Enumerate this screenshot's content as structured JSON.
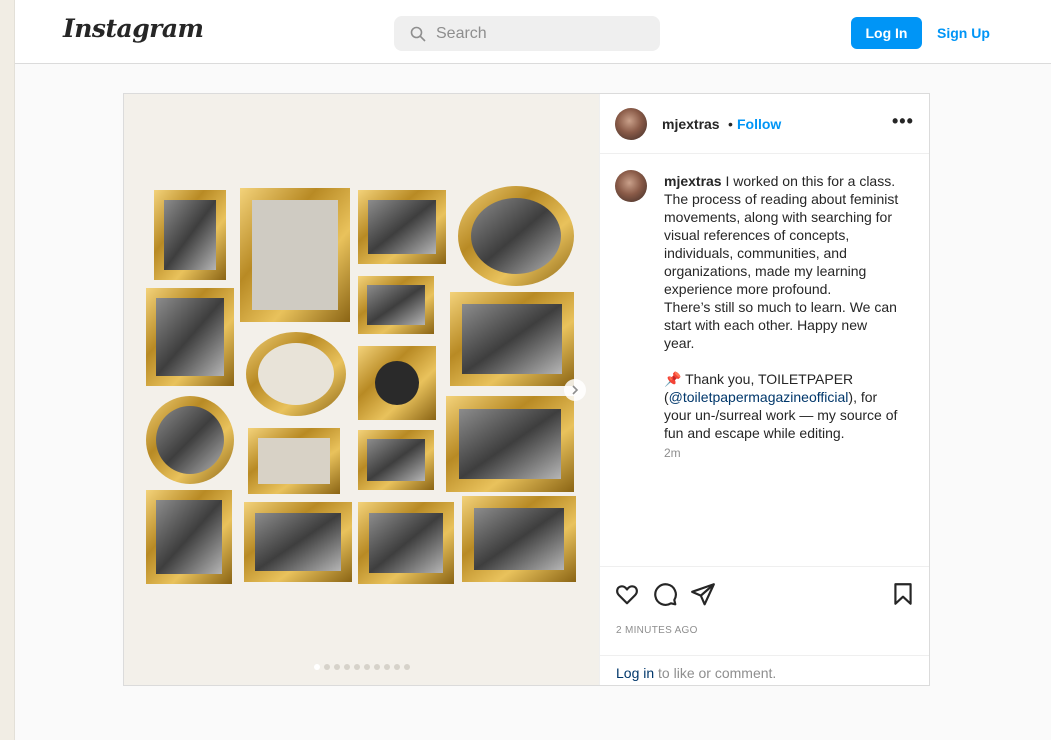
{
  "header": {
    "logo_text": "Instagram",
    "search_placeholder": "Search",
    "login_label": "Log In",
    "signup_label": "Sign Up"
  },
  "post": {
    "username": "mjextras",
    "separator": "•",
    "follow_label": "Follow",
    "more_label": "•••",
    "caption_username": "mjextras",
    "caption_lines": [
      "I worked on this for a class.",
      "The process of reading about feminist",
      "movements, along with searching for",
      "visual references of concepts,",
      "individuals, communities, and",
      "organizations, made my learning",
      "experience more profound.",
      "There’s still so much to learn. We can",
      "start with each other. Happy new",
      "year."
    ],
    "thanks_prefix": "Thank you, TOILETPAPER",
    "thanks_open_paren": "(",
    "mention": "@toiletpapermagazineofficial",
    "thanks_suffix": "), for",
    "thanks_line3": "your un-/surreal work — my source of",
    "thanks_line4": "fun and escape while editing.",
    "time_short": "2m",
    "time_long": "2 MINUTES AGO",
    "login_link": "Log in",
    "login_suffix": " to like or comment.",
    "carousel_count": 10,
    "carousel_active": 1
  },
  "icons": {
    "like": "heart-icon",
    "comment": "comment-icon",
    "share": "share-icon",
    "save": "bookmark-icon",
    "search": "search-icon",
    "next": "chevron-right-icon"
  },
  "colors": {
    "accent": "#0095f6",
    "link": "#00376b",
    "muted": "#8e8e8e",
    "gold": "#c9a23a"
  }
}
